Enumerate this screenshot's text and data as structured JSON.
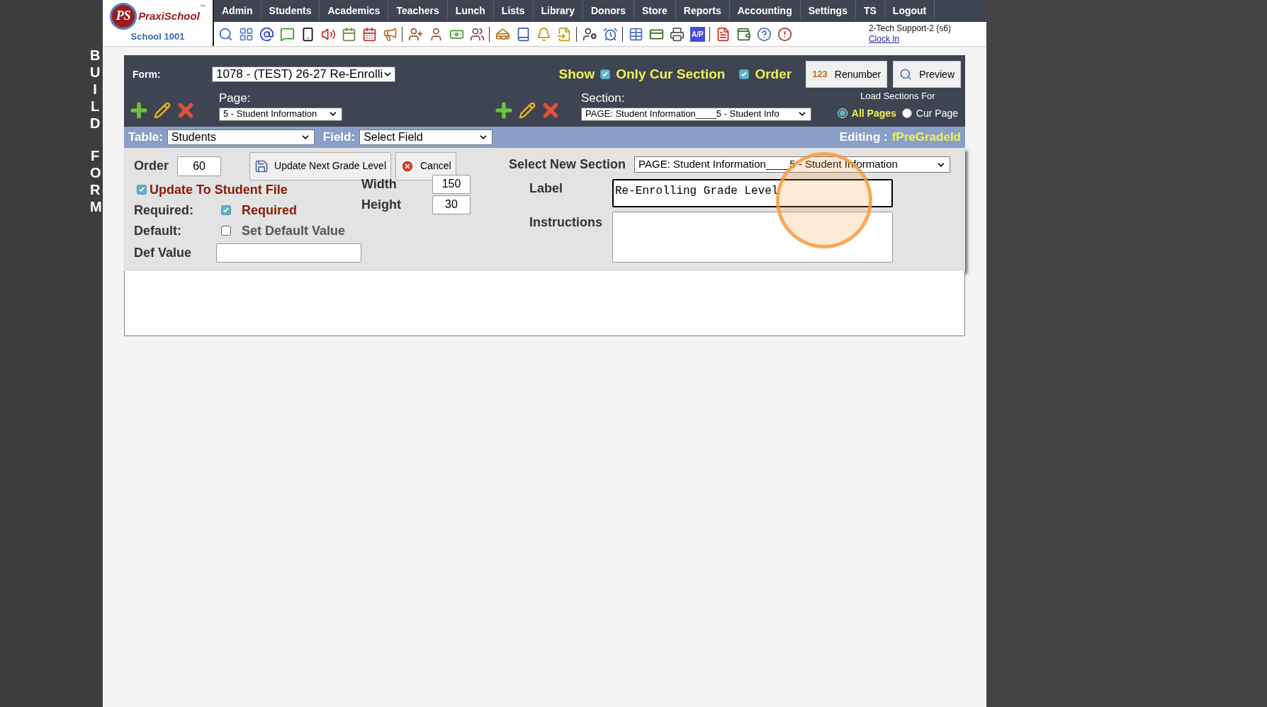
{
  "side_title": "BUILD FORM",
  "logo": {
    "mark": "PS",
    "name": "PraxiSchool",
    "tm": "™",
    "school": "School 1001"
  },
  "nav": [
    "Admin",
    "Students",
    "Academics",
    "Teachers",
    "Lunch",
    "Lists",
    "Library",
    "Donors",
    "Store",
    "Reports",
    "Accounting",
    "Settings",
    "TS",
    "Logout"
  ],
  "toolbar_badge": "A/P",
  "user": {
    "name": "2-Tech Support-2 (s6)",
    "link": "Clock In"
  },
  "form": {
    "label": "Form:",
    "value": "1078 - (TEST) 26-27 Re-Enrolli"
  },
  "show": {
    "label": "Show",
    "options": [
      {
        "label": "Only Cur Section",
        "checked": true
      },
      {
        "label": "Order",
        "checked": true
      }
    ]
  },
  "buttons": [
    {
      "label": "Renumber",
      "icon_text": "123",
      "kind": "renumber"
    },
    {
      "label": "Preview",
      "kind": "preview"
    }
  ],
  "page": {
    "label": "Page:",
    "value": "5 - Student Information"
  },
  "section": {
    "label": "Section:",
    "value": "PAGE: Student Information____5 - Student Info"
  },
  "load_sections": {
    "label": "Load Sections For",
    "options": [
      {
        "label": "All Pages",
        "selected": true
      },
      {
        "label": "Cur Page",
        "selected": false
      }
    ]
  },
  "table": {
    "label": "Table:",
    "value": "Students"
  },
  "field": {
    "label": "Field:",
    "value": "Select Field"
  },
  "editing": {
    "label": "Editing :",
    "value": "fPreGradeId"
  },
  "editor": {
    "order": {
      "label": "Order",
      "value": "60"
    },
    "actions": [
      {
        "label": "Update Next Grade Level",
        "kind": "save"
      },
      {
        "label": "Cancel",
        "kind": "cancel"
      }
    ],
    "update_file": {
      "label": "Update To Student File",
      "checked": true
    },
    "required": {
      "label": "Required:",
      "option": "Required",
      "checked": true
    },
    "default": {
      "label": "Default:",
      "option": "Set Default Value",
      "checked": false
    },
    "def_value": {
      "label": "Def Value"
    },
    "width": {
      "label": "Width",
      "value": "150"
    },
    "height": {
      "label": "Height",
      "value": "30"
    },
    "new_section": {
      "label": "Select New Section",
      "value": "PAGE: Student Information____5 - Student Information"
    },
    "label_field": {
      "label": "Label",
      "value": "Re-Enrolling Grade Level"
    },
    "instructions": {
      "label": "Instructions"
    }
  },
  "click_highlight": true
}
